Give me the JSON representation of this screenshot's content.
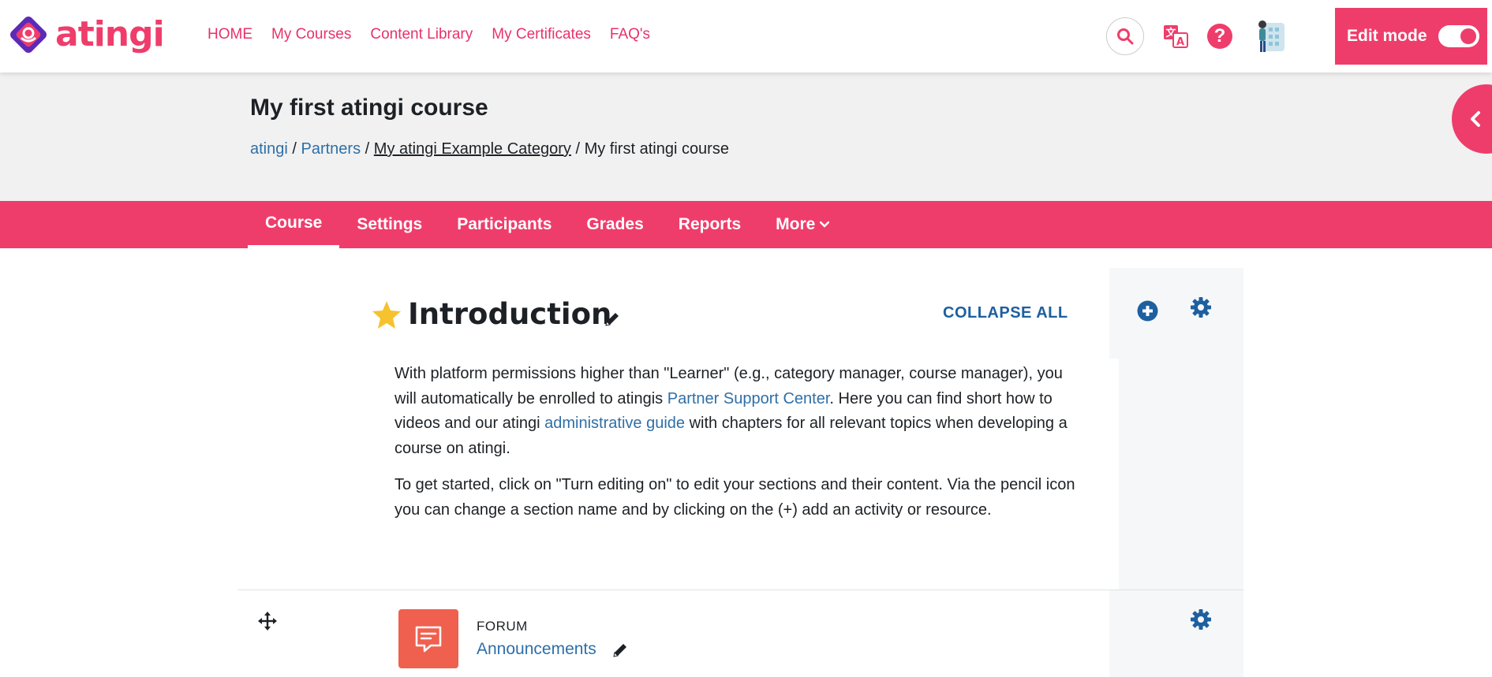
{
  "brand": {
    "name": "atingi",
    "accent": "#ef3d6b"
  },
  "nav": {
    "links": [
      "HOME",
      "My Courses",
      "Content Library",
      "My Certificates",
      "FAQ's"
    ],
    "edit_mode_label": "Edit mode",
    "edit_mode_on": true
  },
  "header": {
    "title": "My first atingi course",
    "breadcrumb": [
      "atingi",
      "Partners",
      "My atingi Example Category",
      "My first atingi course"
    ],
    "separator": "/"
  },
  "secondary_nav": {
    "tabs": [
      "Course",
      "Settings",
      "Participants",
      "Grades",
      "Reports",
      "More"
    ],
    "active": "Course"
  },
  "section": {
    "title": "Introduction",
    "collapse_all_label": "COLLAPSE ALL",
    "p1_a": "With platform permissions higher than \"Learner\" (e.g., category manager, course manager), you will automatically be enrolled to atingis ",
    "p1_link1": "Partner Support Center",
    "p1_b": ". Here you can find short how to videos and our atingi ",
    "p1_link2": "administrative guide",
    "p1_c": " with chapters for all relevant topics when developing a course on atingi.",
    "p2": "To get started, click on \"Turn editing on\" to edit your sections and their content. Via the pencil icon you can change a section name and by clicking on the (+) add an activity or resource."
  },
  "activity": {
    "type": "FORUM",
    "name": "Announcements"
  },
  "icons": [
    "search-icon",
    "translate-icon",
    "help-icon",
    "avatar",
    "chevron-left-icon",
    "star-icon",
    "pencil-icon",
    "add-icon",
    "gear-icon",
    "move-icon",
    "forum-icon"
  ]
}
